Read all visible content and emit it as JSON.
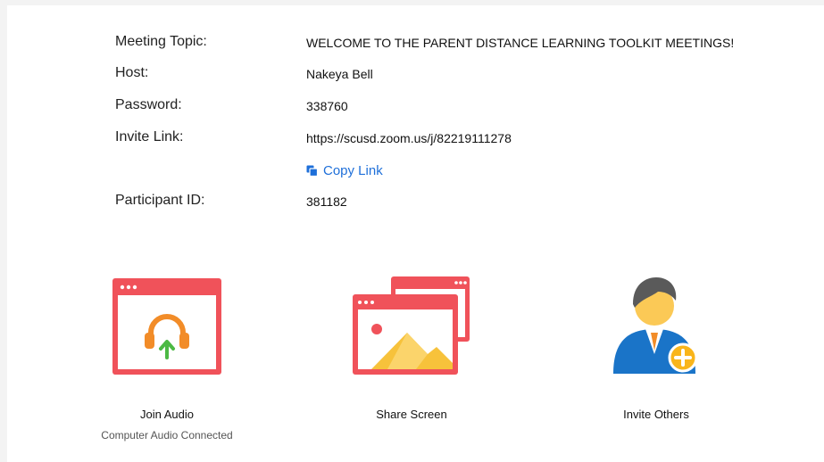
{
  "meeting_info": {
    "rows": [
      {
        "label": "Meeting Topic:",
        "value": "WELCOME TO THE PARENT DISTANCE LEARNING TOOLKIT MEETINGS!"
      },
      {
        "label": "Host:",
        "value": "Nakeya Bell"
      },
      {
        "label": "Password:",
        "value": "338760"
      },
      {
        "label": "Invite Link:",
        "value": "https://scusd.zoom.us/j/82219111278"
      }
    ],
    "copy_link_label": "Copy Link",
    "participant_id_label": "Participant ID:",
    "participant_id_value": "381182"
  },
  "actions": {
    "join_audio": {
      "label": "Join Audio",
      "sublabel": "Computer Audio Connected"
    },
    "share_screen": {
      "label": "Share Screen"
    },
    "invite_others": {
      "label": "Invite Others"
    }
  },
  "colors": {
    "window_red": "#f0525a",
    "link_blue": "#1e6fd9",
    "headset_orange": "#f28c28",
    "arrow_green": "#4cb944",
    "mountain_yellow": "#f7c23b",
    "person_blue": "#1a74c8",
    "plus_gold": "#f9b51b"
  },
  "icons": {
    "copy": "copy-icon",
    "join_audio": "join-audio-icon",
    "share_screen": "share-screen-icon",
    "invite_others": "invite-others-icon"
  }
}
